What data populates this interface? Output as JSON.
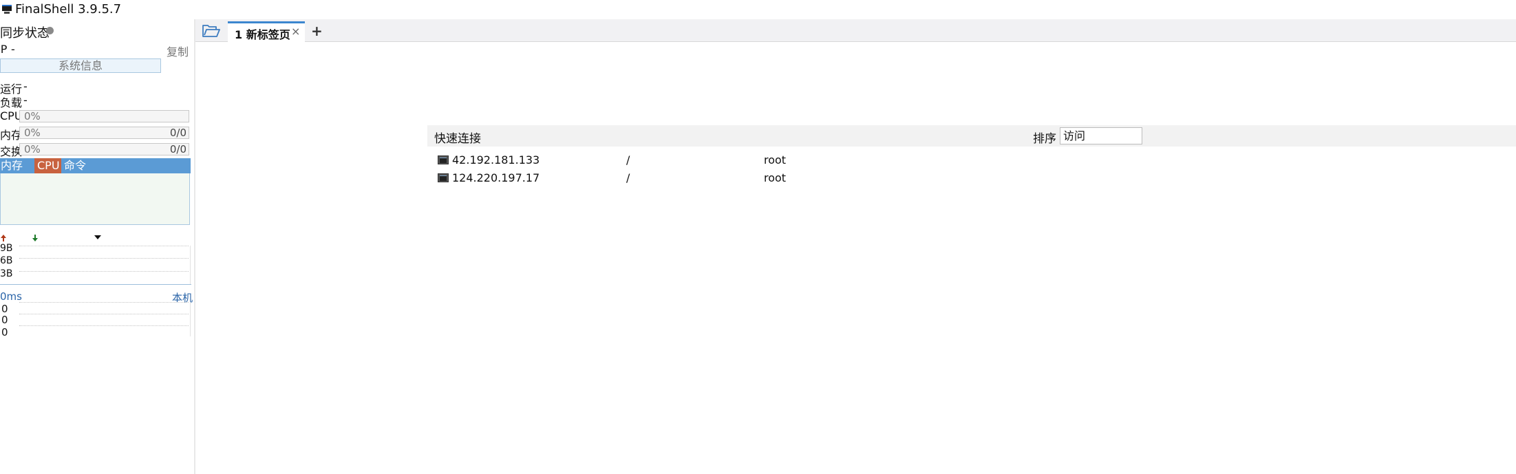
{
  "window": {
    "title": "FinalShell 3.9.5.7"
  },
  "sidebar": {
    "sync_label": "同步状态",
    "ip_label": "IP",
    "ip_value": "-",
    "copy_label": "复制",
    "sysinfo_label": "系统信息",
    "uptime_label": "运行",
    "uptime_value": "-",
    "load_label": "负载",
    "load_value": "-",
    "cpu": {
      "label": "CPU",
      "percent": "0%"
    },
    "memory": {
      "label": "内存",
      "percent": "0%",
      "ratio": "0/0"
    },
    "swap": {
      "label": "交换",
      "percent": "0%",
      "ratio": "0/0"
    },
    "process_table": {
      "columns": [
        "内存",
        "CPU",
        "命令"
      ]
    },
    "network": {
      "y_ticks": [
        "9B",
        "6B",
        "3B"
      ]
    },
    "ping": {
      "latency": "0ms",
      "target": "本机",
      "values": [
        "0",
        "0",
        "0"
      ]
    }
  },
  "tabs": [
    {
      "label": "1 新标签页",
      "close": "×"
    }
  ],
  "tab_add": "+",
  "quick_connect": {
    "title": "快速连接",
    "sort_label": "排序",
    "sort_value": "访问",
    "rows": [
      {
        "host": "42.192.181.133",
        "path": "/",
        "user": "root"
      },
      {
        "host": "124.220.197.17",
        "path": "/",
        "user": "root"
      }
    ]
  },
  "colors": {
    "accent": "#3b86cf",
    "process_header": "#5b9bd5",
    "cpu_column": "#c8623f",
    "upload_arrow": "#b03a1a",
    "download_arrow": "#1e7a2a"
  }
}
